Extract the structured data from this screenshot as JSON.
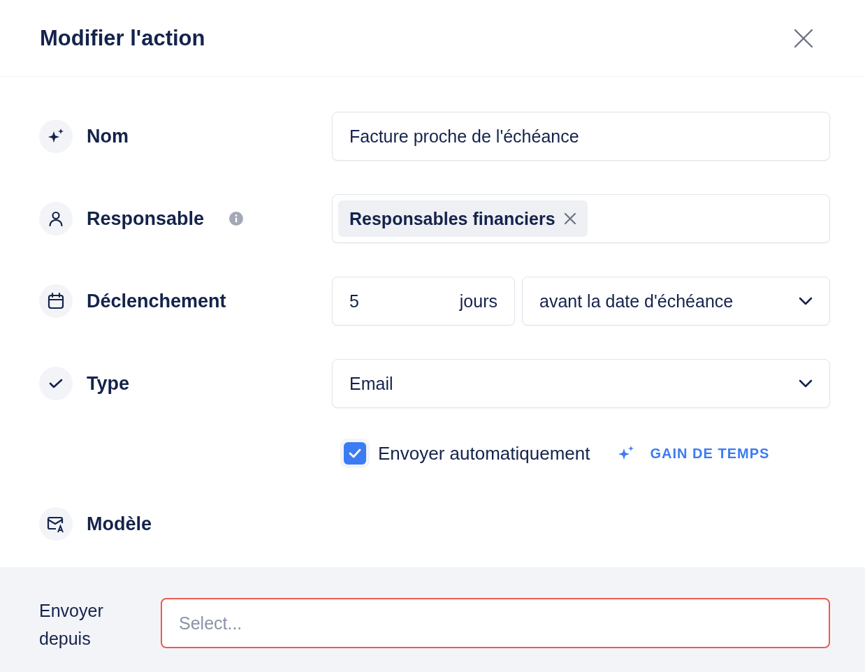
{
  "dialog": {
    "title": "Modifier l'action"
  },
  "fields": [
    {
      "kind": "text",
      "label": "Nom",
      "value": "Facture proche de l'échéance"
    },
    {
      "kind": "tags",
      "label": "Responsable",
      "info": true,
      "tags": [
        "Responsables financiers"
      ]
    },
    {
      "kind": "duration",
      "label": "Déclenchement",
      "amount": "5",
      "unit": "jours",
      "relation": "avant la date d'échéance"
    },
    {
      "kind": "select",
      "label": "Type",
      "value": "Email"
    },
    {
      "kind": "checkbox",
      "label": "Envoyer automatiquement",
      "checked": true,
      "badge": "GAIN DE TEMPS"
    },
    {
      "kind": "heading",
      "label": "Modèle"
    }
  ],
  "send_from": {
    "label": "Envoyer depuis",
    "placeholder": "Select...",
    "invalid": true
  }
}
